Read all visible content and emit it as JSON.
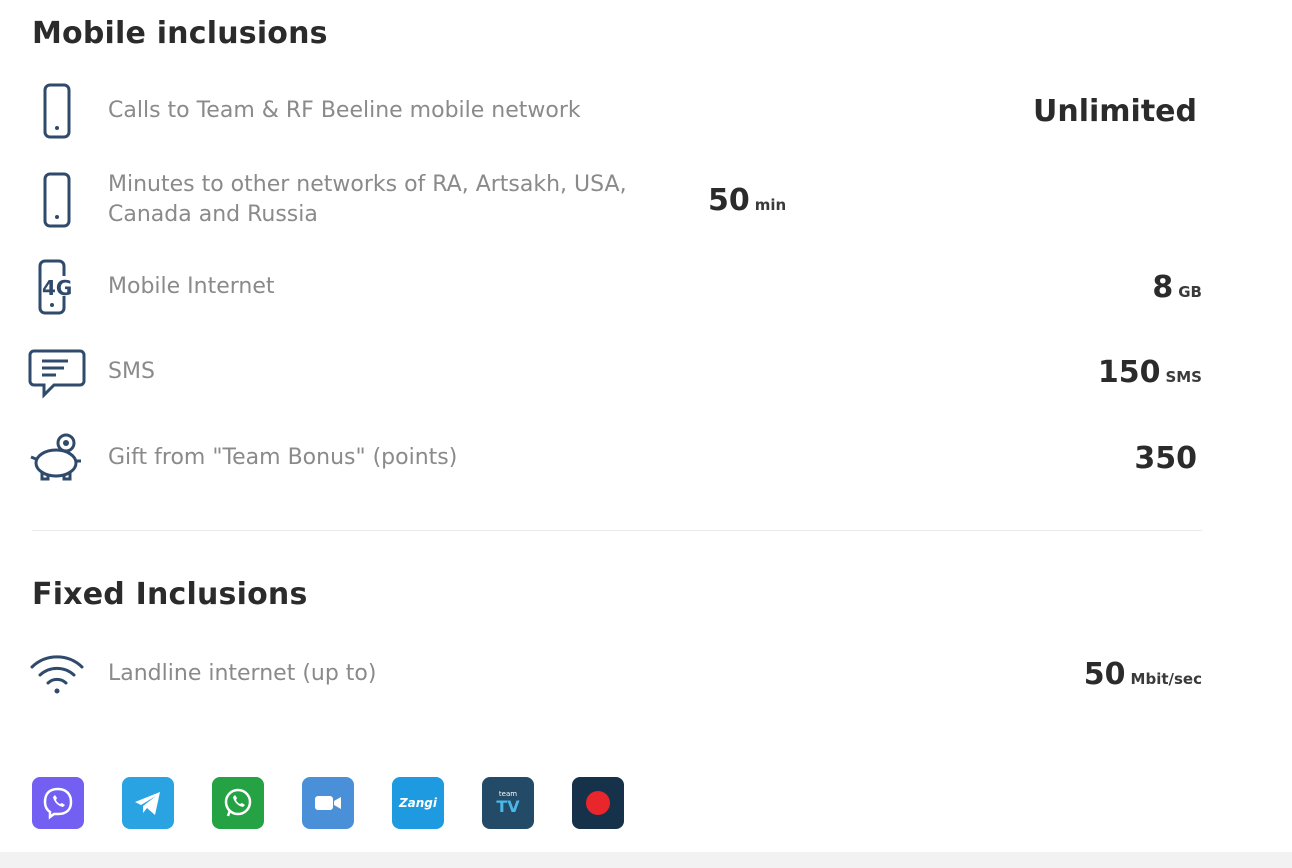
{
  "mobile": {
    "title": "Mobile inclusions",
    "items": [
      {
        "icon": "phone-icon",
        "label": "Calls to Team & RF Beeline mobile network",
        "value": "Unlimited",
        "unit": ""
      },
      {
        "icon": "phone-icon",
        "label": "Minutes to other networks of RA, Artsakh, USA, Canada and Russia",
        "value": "50",
        "unit": "min"
      },
      {
        "icon": "4g-phone-icon",
        "label": "Mobile Internet",
        "value": "8",
        "unit": "GB"
      },
      {
        "icon": "sms-bubble-icon",
        "label": "SMS",
        "value": "150",
        "unit": "SMS"
      },
      {
        "icon": "piggy-bank-icon",
        "label": "Gift from \"Team Bonus\" (points)",
        "value": "350",
        "unit": ""
      }
    ]
  },
  "fixed": {
    "title": "Fixed Inclusions",
    "items": [
      {
        "icon": "wifi-icon",
        "label": "Landline internet (up to)",
        "value": "50",
        "unit": "Mbit/sec"
      }
    ]
  },
  "apps": [
    {
      "name": "viber",
      "color": "#7360f2",
      "glyph": ""
    },
    {
      "name": "telegram",
      "color": "#2aa3e3",
      "glyph": ""
    },
    {
      "name": "whatsapp",
      "color": "#25a244",
      "glyph": ""
    },
    {
      "name": "video",
      "color": "#4a90d9",
      "glyph": ""
    },
    {
      "name": "zangi",
      "color": "#1e9be0",
      "glyph": "Zangi"
    },
    {
      "name": "team-tv",
      "color": "#234a66",
      "glyph_top": "team",
      "glyph": "TV"
    },
    {
      "name": "record",
      "color": "#16324a",
      "glyph": ""
    }
  ],
  "colors": {
    "icon_stroke": "#2f4a6b",
    "label": "#8a8a8a",
    "value": "#2b2b2b"
  }
}
